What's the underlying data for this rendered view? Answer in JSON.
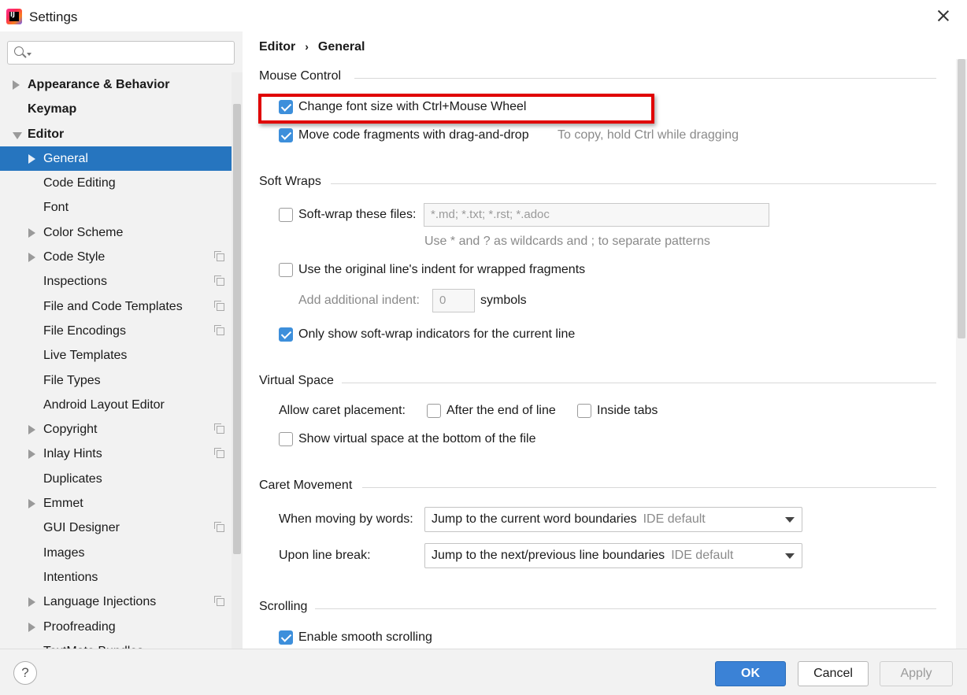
{
  "window": {
    "title": "Settings",
    "close_icon": "close-icon",
    "app_icon_text": "IJ"
  },
  "search": {
    "value": "",
    "placeholder": ""
  },
  "sidebar": {
    "items": [
      {
        "label": "Appearance & Behavior",
        "level": 0,
        "arrow": "right",
        "bold": true,
        "copy": false,
        "selected": false
      },
      {
        "label": "Keymap",
        "level": 0,
        "arrow": "none",
        "bold": true,
        "copy": false,
        "selected": false
      },
      {
        "label": "Editor",
        "level": 0,
        "arrow": "down",
        "bold": true,
        "copy": false,
        "selected": false
      },
      {
        "label": "General",
        "level": 1,
        "arrow": "right",
        "bold": false,
        "copy": false,
        "selected": true
      },
      {
        "label": "Code Editing",
        "level": 1,
        "arrow": "none",
        "bold": false,
        "copy": false,
        "selected": false
      },
      {
        "label": "Font",
        "level": 1,
        "arrow": "none",
        "bold": false,
        "copy": false,
        "selected": false
      },
      {
        "label": "Color Scheme",
        "level": 1,
        "arrow": "right",
        "bold": false,
        "copy": false,
        "selected": false
      },
      {
        "label": "Code Style",
        "level": 1,
        "arrow": "right",
        "bold": false,
        "copy": true,
        "selected": false
      },
      {
        "label": "Inspections",
        "level": 1,
        "arrow": "none",
        "bold": false,
        "copy": true,
        "selected": false
      },
      {
        "label": "File and Code Templates",
        "level": 1,
        "arrow": "none",
        "bold": false,
        "copy": true,
        "selected": false
      },
      {
        "label": "File Encodings",
        "level": 1,
        "arrow": "none",
        "bold": false,
        "copy": true,
        "selected": false
      },
      {
        "label": "Live Templates",
        "level": 1,
        "arrow": "none",
        "bold": false,
        "copy": false,
        "selected": false
      },
      {
        "label": "File Types",
        "level": 1,
        "arrow": "none",
        "bold": false,
        "copy": false,
        "selected": false
      },
      {
        "label": "Android Layout Editor",
        "level": 1,
        "arrow": "none",
        "bold": false,
        "copy": false,
        "selected": false
      },
      {
        "label": "Copyright",
        "level": 1,
        "arrow": "right",
        "bold": false,
        "copy": true,
        "selected": false
      },
      {
        "label": "Inlay Hints",
        "level": 1,
        "arrow": "right",
        "bold": false,
        "copy": true,
        "selected": false
      },
      {
        "label": "Duplicates",
        "level": 1,
        "arrow": "none",
        "bold": false,
        "copy": false,
        "selected": false
      },
      {
        "label": "Emmet",
        "level": 1,
        "arrow": "right",
        "bold": false,
        "copy": false,
        "selected": false
      },
      {
        "label": "GUI Designer",
        "level": 1,
        "arrow": "none",
        "bold": false,
        "copy": true,
        "selected": false
      },
      {
        "label": "Images",
        "level": 1,
        "arrow": "none",
        "bold": false,
        "copy": false,
        "selected": false
      },
      {
        "label": "Intentions",
        "level": 1,
        "arrow": "none",
        "bold": false,
        "copy": false,
        "selected": false
      },
      {
        "label": "Language Injections",
        "level": 1,
        "arrow": "right",
        "bold": false,
        "copy": true,
        "selected": false
      },
      {
        "label": "Proofreading",
        "level": 1,
        "arrow": "right",
        "bold": false,
        "copy": false,
        "selected": false
      },
      {
        "label": "TextMate Bundles",
        "level": 1,
        "arrow": "none",
        "bold": false,
        "copy": false,
        "selected": false
      }
    ]
  },
  "breadcrumb": {
    "parent": "Editor",
    "separator": "›",
    "current": "General"
  },
  "mouse_control": {
    "title": "Mouse Control",
    "change_font_size": {
      "label": "Change font size with Ctrl+Mouse Wheel",
      "checked": true
    },
    "drag_and_drop": {
      "label": "Move code fragments with drag-and-drop",
      "checked": true,
      "hint": "To copy, hold Ctrl while dragging"
    }
  },
  "soft_wraps": {
    "title": "Soft Wraps",
    "soft_wrap_files": {
      "label": "Soft-wrap these files:",
      "checked": false,
      "value": "*.md; *.txt; *.rst; *.adoc"
    },
    "wildcard_hint": "Use * and ? as wildcards and ; to separate patterns",
    "original_indent": {
      "label": "Use the original line's indent for wrapped fragments",
      "checked": false
    },
    "additional_indent": {
      "label": "Add additional indent:",
      "value": "0",
      "unit": "symbols"
    },
    "indicators": {
      "label": "Only show soft-wrap indicators for the current line",
      "checked": true
    }
  },
  "virtual_space": {
    "title": "Virtual Space",
    "caret_label": "Allow caret placement:",
    "after_end": {
      "label": "After the end of line",
      "checked": false
    },
    "inside_tabs": {
      "label": "Inside tabs",
      "checked": false
    },
    "bottom": {
      "label": "Show virtual space at the bottom of the file",
      "checked": false
    }
  },
  "caret_movement": {
    "title": "Caret Movement",
    "by_words": {
      "label": "When moving by words:",
      "value": "Jump to the current word boundaries",
      "hint": "IDE default"
    },
    "line_break": {
      "label": "Upon line break:",
      "value": "Jump to the next/previous line boundaries",
      "hint": "IDE default"
    }
  },
  "scrolling": {
    "title": "Scrolling",
    "smooth": {
      "label": "Enable smooth scrolling",
      "checked": true
    }
  },
  "footer": {
    "help": "?",
    "ok": "OK",
    "cancel": "Cancel",
    "apply": "Apply"
  },
  "colors": {
    "selection": "#2675bf",
    "highlight": "#e00000",
    "checkbox": "#3d8fdb",
    "ok_button": "#3b82d6"
  }
}
